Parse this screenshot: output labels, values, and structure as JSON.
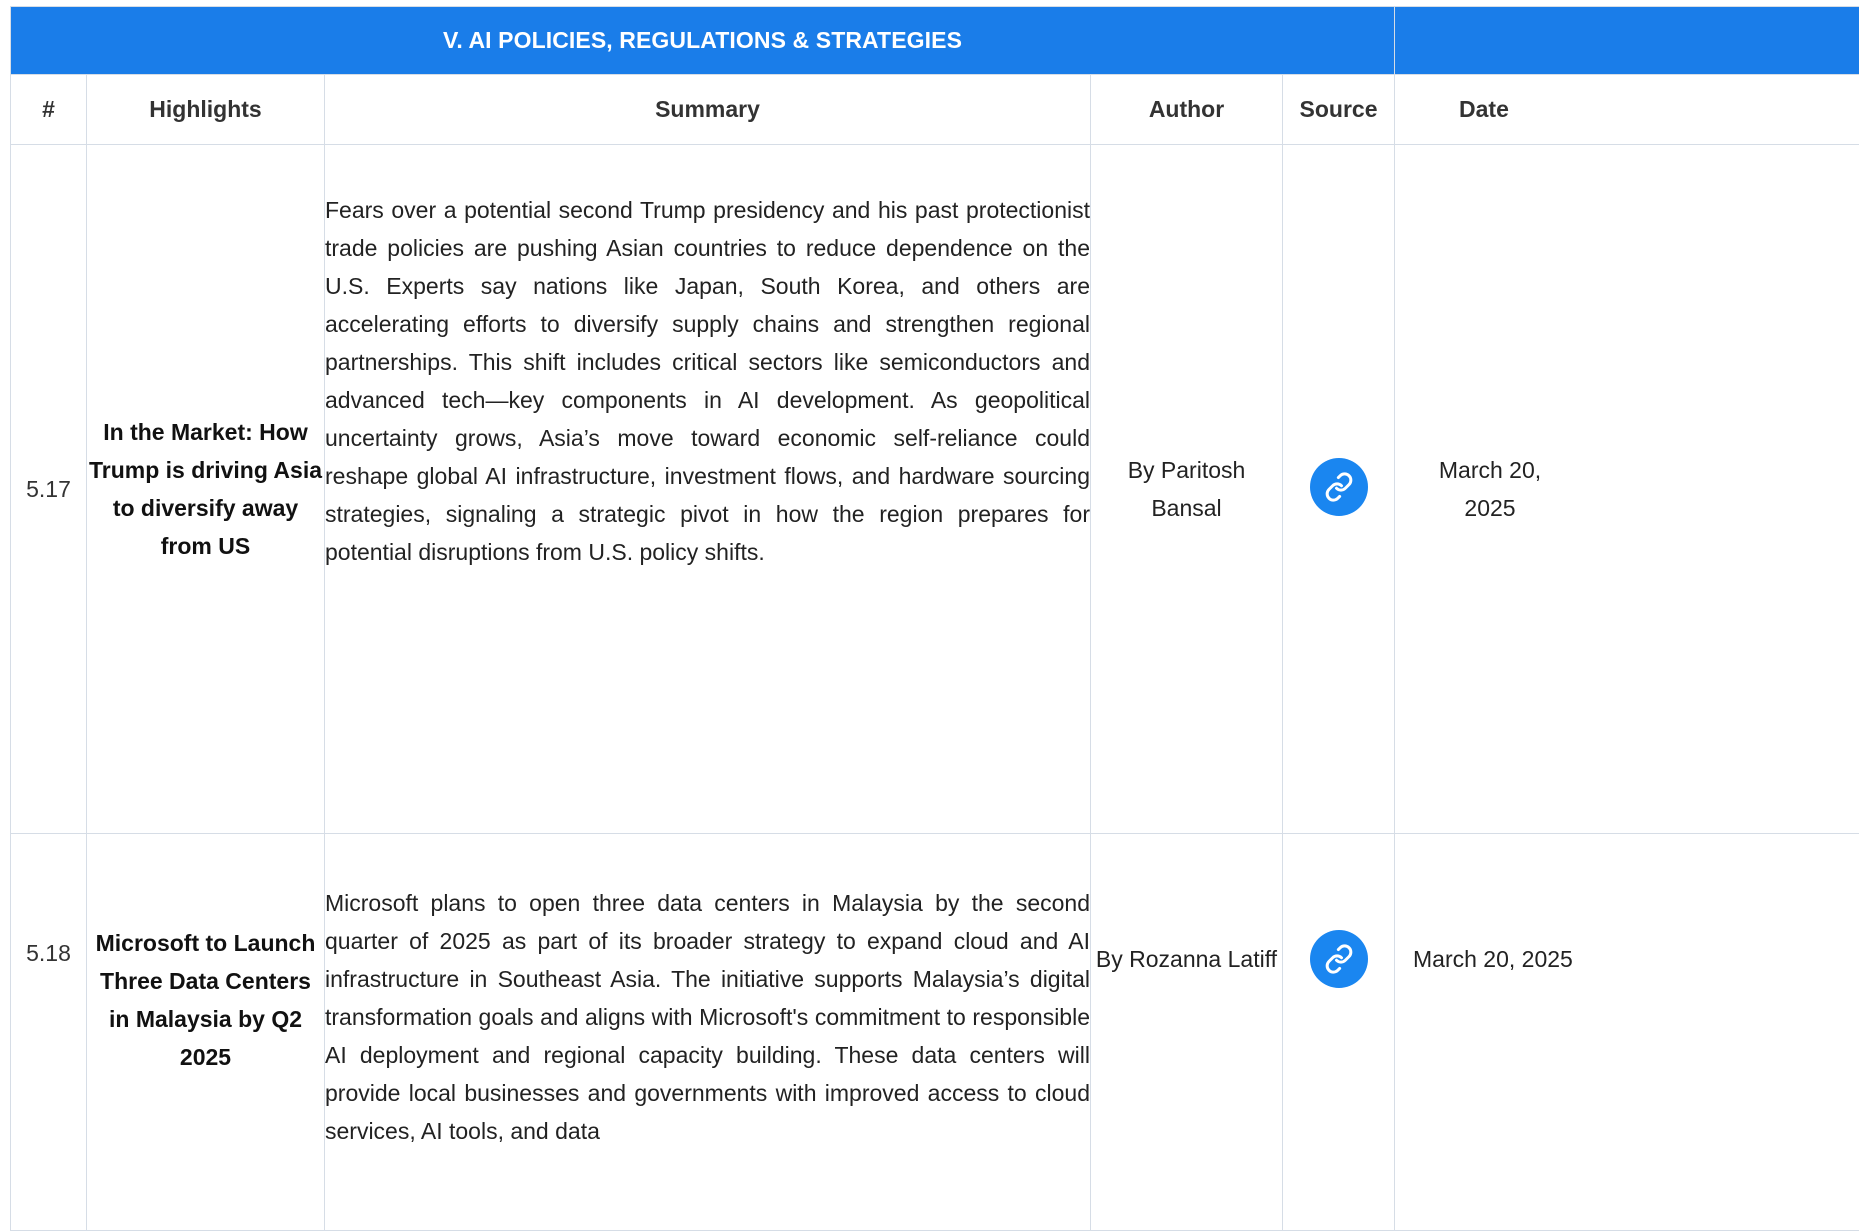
{
  "section": {
    "title": "V. AI POLICIES, REGULATIONS & STRATEGIES"
  },
  "columns": {
    "num": "#",
    "highlights": "Highlights",
    "summary": "Summary",
    "author": "Author",
    "source": "Source",
    "date": "Date"
  },
  "rows": [
    {
      "num": "5.17",
      "highlight": "In the Market: How Trump is driving Asia to diversify away from US",
      "summary": "Fears over a potential second Trump presidency and his past protectionist trade policies are pushing Asian countries to reduce dependence on the U.S. Experts say nations like Japan, South Korea, and others are accelerating efforts to diversify supply chains and strengthen regional partnerships. This shift includes critical sectors like semiconductors and advanced tech—key components in AI development. As geopolitical uncertainty grows, Asia’s move toward economic self-reliance could reshape global AI infrastructure, investment flows, and hardware sourcing strategies, signaling a strategic pivot in how the region prepares for potential disruptions from U.S. policy shifts.",
      "author": "By Paritosh Bansal",
      "source_icon": "link-icon",
      "date": "March 20, 2025"
    },
    {
      "num": "5.18",
      "highlight": "Microsoft to Launch Three Data Centers in Malaysia by Q2 2025",
      "summary": "Microsoft plans to open three data centers in Malaysia by the second quarter of 2025 as part of its broader strategy to expand cloud and AI infrastructure in Southeast Asia. The initiative supports Malaysia’s digital transformation goals and aligns with Microsoft's commitment to responsible AI deployment and regional capacity building. These data centers will provide local businesses and governments with improved access to cloud services, AI tools, and data",
      "author": "By Rozanna Latiff",
      "source_icon": "link-icon",
      "date": "March 20, 2025"
    }
  ],
  "colors": {
    "section_bg": "#1a7de9",
    "link_button": "#1a86f0",
    "grid_line": "#d6dde6"
  }
}
